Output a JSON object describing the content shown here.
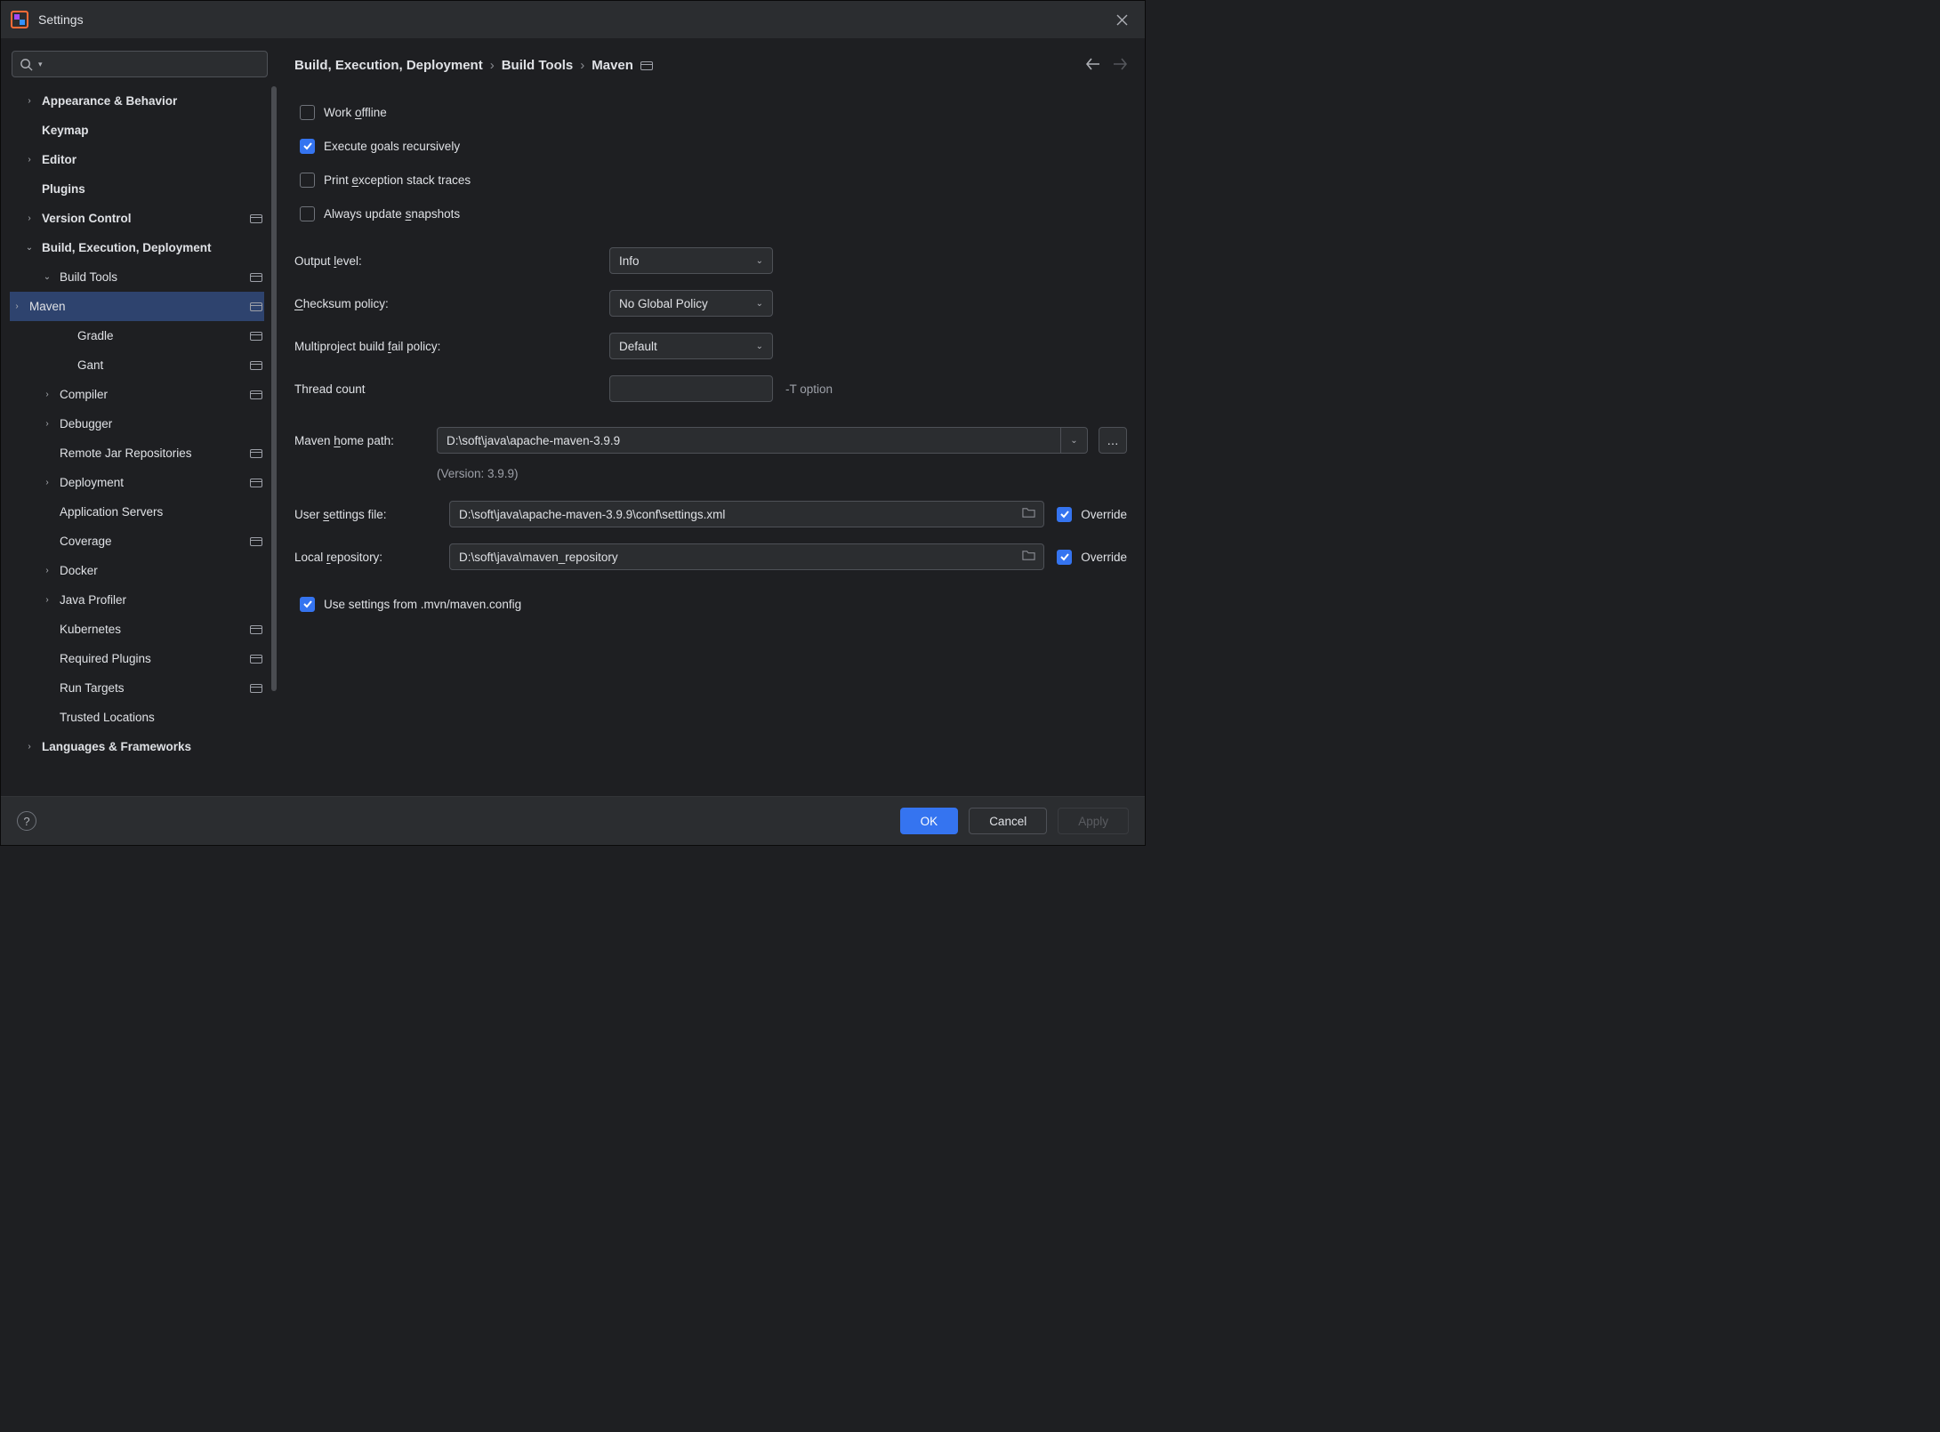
{
  "header": {
    "title": "Settings"
  },
  "breadcrumb": {
    "parts": [
      "Build, Execution, Deployment",
      "Build Tools",
      "Maven"
    ]
  },
  "sidebar": {
    "items": [
      {
        "label": "Appearance & Behavior",
        "bold": true,
        "twisty": ">",
        "indent": 0,
        "marker": false
      },
      {
        "label": "Keymap",
        "bold": true,
        "twisty": "",
        "indent": 0,
        "marker": false
      },
      {
        "label": "Editor",
        "bold": true,
        "twisty": ">",
        "indent": 0,
        "marker": false
      },
      {
        "label": "Plugins",
        "bold": true,
        "twisty": "",
        "indent": 0,
        "marker": false
      },
      {
        "label": "Version Control",
        "bold": true,
        "twisty": ">",
        "indent": 0,
        "marker": true
      },
      {
        "label": "Build, Execution, Deployment",
        "bold": true,
        "twisty": "v",
        "indent": 0,
        "marker": false
      },
      {
        "label": "Build Tools",
        "bold": false,
        "twisty": "v",
        "indent": 1,
        "marker": true
      },
      {
        "label": "Maven",
        "bold": false,
        "twisty": ">",
        "indent": 2,
        "marker": true,
        "selected": true
      },
      {
        "label": "Gradle",
        "bold": false,
        "twisty": "",
        "indent": 2,
        "marker": true
      },
      {
        "label": "Gant",
        "bold": false,
        "twisty": "",
        "indent": 2,
        "marker": true
      },
      {
        "label": "Compiler",
        "bold": false,
        "twisty": ">",
        "indent": 1,
        "marker": true
      },
      {
        "label": "Debugger",
        "bold": false,
        "twisty": ">",
        "indent": 1,
        "marker": false
      },
      {
        "label": "Remote Jar Repositories",
        "bold": false,
        "twisty": "",
        "indent": 1,
        "marker": true
      },
      {
        "label": "Deployment",
        "bold": false,
        "twisty": ">",
        "indent": 1,
        "marker": true
      },
      {
        "label": "Application Servers",
        "bold": false,
        "twisty": "",
        "indent": 1,
        "marker": false
      },
      {
        "label": "Coverage",
        "bold": false,
        "twisty": "",
        "indent": 1,
        "marker": true
      },
      {
        "label": "Docker",
        "bold": false,
        "twisty": ">",
        "indent": 1,
        "marker": false
      },
      {
        "label": "Java Profiler",
        "bold": false,
        "twisty": ">",
        "indent": 1,
        "marker": false
      },
      {
        "label": "Kubernetes",
        "bold": false,
        "twisty": "",
        "indent": 1,
        "marker": true
      },
      {
        "label": "Required Plugins",
        "bold": false,
        "twisty": "",
        "indent": 1,
        "marker": true
      },
      {
        "label": "Run Targets",
        "bold": false,
        "twisty": "",
        "indent": 1,
        "marker": true
      },
      {
        "label": "Trusted Locations",
        "bold": false,
        "twisty": "",
        "indent": 1,
        "marker": false
      },
      {
        "label": "Languages & Frameworks",
        "bold": true,
        "twisty": ">",
        "indent": 0,
        "marker": false
      }
    ]
  },
  "form": {
    "checkboxes": {
      "work_offline": {
        "label_pre": "Work ",
        "key": "o",
        "label_post": "ffline",
        "checked": false
      },
      "execute_recursive": {
        "label": "Execute goals recursively",
        "checked": true
      },
      "print_exc": {
        "label_pre": "Print ",
        "key": "e",
        "label_post": "xception stack traces",
        "checked": false
      },
      "update_snapshots": {
        "label_pre": "Always update ",
        "key": "s",
        "label_post": "napshots",
        "checked": false
      },
      "use_mvn_config": {
        "label": "Use settings from .mvn/maven.config",
        "checked": true
      }
    },
    "fields": {
      "output_level": {
        "label_pre": "Output ",
        "key": "l",
        "label_post": "evel:",
        "value": "Info"
      },
      "checksum": {
        "label_pre": "",
        "key": "C",
        "label_post": "hecksum policy:",
        "value": "No Global Policy"
      },
      "fail_policy": {
        "label_pre": "Multiproject build ",
        "key": "f",
        "label_post": "ail policy:",
        "value": "Default"
      },
      "thread_count": {
        "label": "Thread count",
        "value": "",
        "hint": "-T option"
      },
      "maven_home": {
        "label_pre": "Maven ",
        "key": "h",
        "label_post": "ome path:",
        "value": "D:\\soft\\java\\apache-maven-3.9.9"
      },
      "version_text": "(Version: 3.9.9)",
      "user_settings": {
        "label_pre": "User ",
        "key": "s",
        "label_post": "ettings file:",
        "value": "D:\\soft\\java\\apache-maven-3.9.9\\conf\\settings.xml",
        "override": true
      },
      "local_repo": {
        "label_pre": "Local ",
        "key": "r",
        "label_post": "epository:",
        "value": "D:\\soft\\java\\maven_repository",
        "override": true
      }
    },
    "override_label": "Override"
  },
  "footer": {
    "ok": "OK",
    "cancel": "Cancel",
    "apply": "Apply"
  }
}
